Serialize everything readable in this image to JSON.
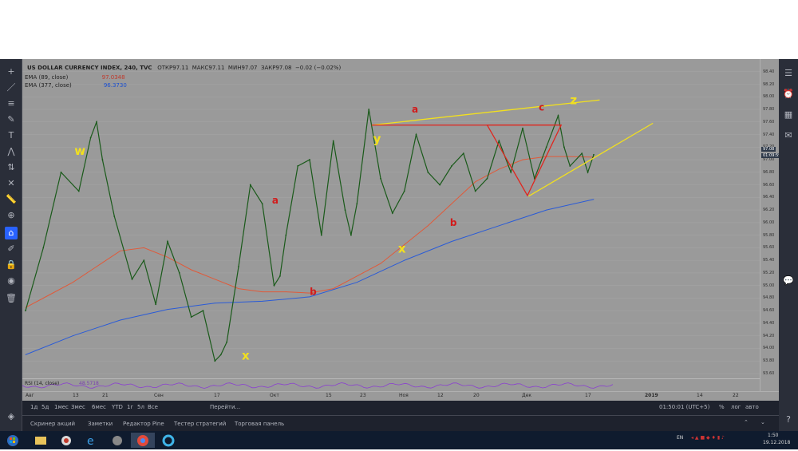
{
  "legend": {
    "symbol": "US DOLLAR CURRENCY INDEX, 240, TVC",
    "open_label": "ОТКР",
    "open": "97.11",
    "high_label": "МАКС",
    "high": "97.11",
    "low_label": "МИН",
    "low": "97.07",
    "close_label": "ЗАКР",
    "close": "97.08",
    "change": "−0.02 (−0.02%)",
    "ema1_label": "EMA (89, close)",
    "ema1_value": "97.0348",
    "ema2_label": "EMA (377, close)",
    "ema2_value": "96.3730",
    "rsi_label": "RSI (14, close)",
    "rsi_value": "48.5718"
  },
  "price_badges": {
    "last": "97.08",
    "countdown": "01:09:59"
  },
  "wave_labels": [
    {
      "text": "w",
      "color": "#f2e01e"
    },
    {
      "text": "x",
      "color": "#f2e01e"
    },
    {
      "text": "a",
      "color": "#d11b1b"
    },
    {
      "text": "b",
      "color": "#d11b1b"
    },
    {
      "text": "y",
      "color": "#f2e01e"
    },
    {
      "text": "x",
      "color": "#f2e01e"
    },
    {
      "text": "a",
      "color": "#d11b1b"
    },
    {
      "text": "b",
      "color": "#d11b1b"
    },
    {
      "text": "c",
      "color": "#d11b1b"
    },
    {
      "text": "z",
      "color": "#f2e01e"
    }
  ],
  "chart_data": {
    "type": "line",
    "title": "US DOLLAR CURRENCY INDEX, 240, TVC",
    "xlabel": "",
    "ylabel": "",
    "ylim": [
      93.6,
      98.6
    ],
    "y_ticks": [
      "98.40",
      "98.20",
      "98.00",
      "97.80",
      "97.60",
      "97.40",
      "97.20",
      "97.00",
      "96.80",
      "96.60",
      "96.40",
      "96.20",
      "96.00",
      "95.80",
      "95.60",
      "95.40",
      "95.20",
      "95.00",
      "94.80",
      "94.60",
      "94.40",
      "94.20",
      "94.00",
      "93.80",
      "93.60"
    ],
    "x_ticks": [
      "Авг",
      "13",
      "21",
      "Сен",
      "17",
      "Окт",
      "15",
      "23",
      "Ноя",
      "12",
      "20",
      "Дек",
      "17",
      "2019",
      "14",
      "22"
    ],
    "series": [
      {
        "name": "EMA (89, close)",
        "color": "#e05a3a",
        "x": [
          0,
          4,
          8,
          12,
          16,
          20,
          24,
          28,
          32,
          36,
          40,
          44,
          48,
          52,
          56,
          60,
          64,
          68,
          72,
          76,
          80,
          84,
          88,
          92,
          96
        ],
        "y": [
          94.65,
          94.85,
          95.05,
          95.3,
          95.55,
          95.6,
          95.45,
          95.25,
          95.1,
          94.95,
          94.9,
          94.9,
          94.88,
          94.95,
          95.15,
          95.35,
          95.65,
          95.95,
          96.3,
          96.65,
          96.85,
          97.0,
          97.05,
          97.05,
          97.04
        ]
      },
      {
        "name": "EMA (377, close)",
        "color": "#2a5bd7",
        "x": [
          0,
          8,
          16,
          24,
          32,
          40,
          48,
          56,
          64,
          72,
          80,
          88,
          96
        ],
        "y": [
          93.9,
          94.2,
          94.45,
          94.62,
          94.72,
          94.75,
          94.82,
          95.05,
          95.4,
          95.7,
          95.95,
          96.2,
          96.37
        ]
      },
      {
        "name": "close",
        "color": "#1a5a1a",
        "x": [
          0,
          3,
          6,
          9,
          11,
          12,
          13,
          15,
          18,
          20,
          22,
          24,
          26,
          28,
          30,
          32,
          33,
          34,
          36,
          38,
          40,
          42,
          43,
          44,
          46,
          48,
          50,
          52,
          54,
          55,
          56,
          58,
          60,
          62,
          64,
          66,
          68,
          70,
          72,
          74,
          76,
          78,
          80,
          82,
          84,
          86,
          88,
          90,
          91,
          92,
          94,
          95,
          96
        ],
        "y": [
          94.6,
          95.6,
          96.8,
          96.5,
          97.35,
          97.6,
          97.0,
          96.1,
          95.1,
          95.4,
          94.7,
          95.7,
          95.2,
          94.5,
          94.6,
          93.8,
          93.9,
          94.1,
          95.3,
          96.6,
          96.3,
          95.0,
          95.15,
          95.8,
          96.9,
          97.0,
          95.8,
          97.3,
          96.2,
          95.8,
          96.3,
          97.8,
          96.7,
          96.15,
          96.5,
          97.4,
          96.8,
          96.6,
          96.9,
          97.1,
          96.5,
          96.7,
          97.3,
          96.8,
          97.5,
          96.7,
          97.2,
          97.7,
          97.2,
          96.9,
          97.1,
          96.8,
          97.08
        ]
      }
    ],
    "grid": true,
    "legend_position": "top-left"
  },
  "bottom_toolbar": {
    "ranges": [
      "1д",
      "5д",
      "1мес",
      "3мес",
      "6мес",
      "YTD",
      "1г",
      "5л",
      "Все"
    ],
    "goto": "Перейти...",
    "clock": "01:50:01 (UTC+5)",
    "pct": "%",
    "log": "лог",
    "auto": "авто"
  },
  "bottom_tabs": [
    "Скринер акций",
    "Заметки",
    "Редактор Pine",
    "Тестер стратегий",
    "Торговая панель"
  ],
  "taskbar": {
    "lang": "EN",
    "time": "1:50",
    "date": "19.12.2018"
  }
}
